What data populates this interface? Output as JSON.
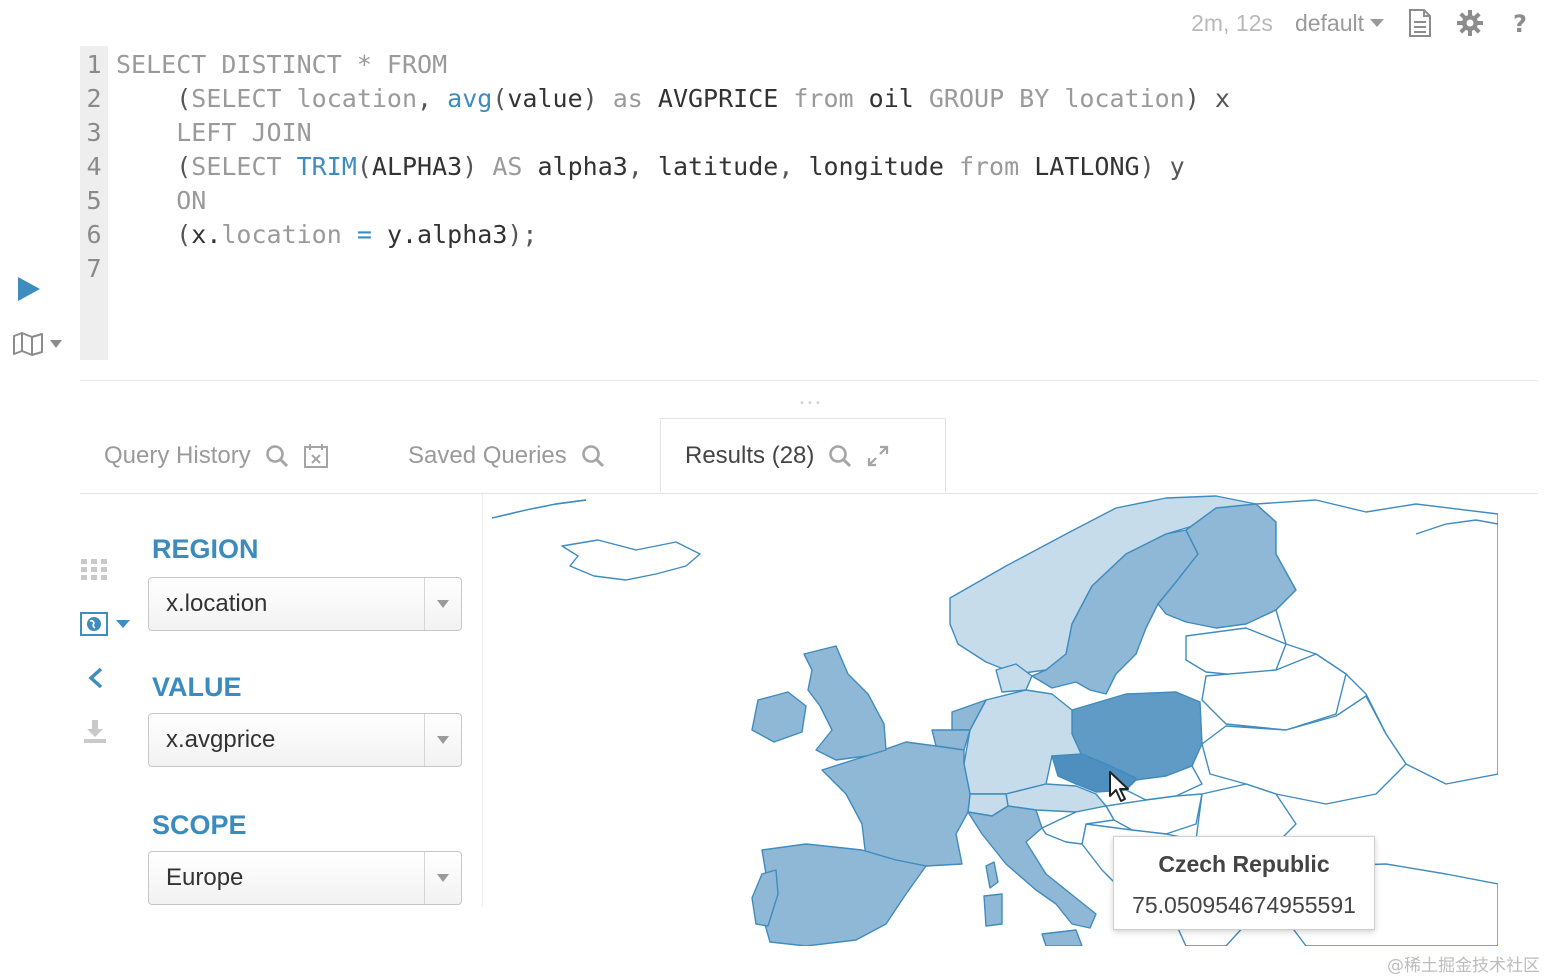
{
  "topbar": {
    "elapsed": "2m, 12s",
    "database": "default",
    "icons": [
      "document-icon",
      "gear-icon",
      "help-icon"
    ]
  },
  "editor": {
    "lines": [
      {
        "n": "1",
        "tokens": [
          [
            "kw",
            "SELECT DISTINCT * FROM"
          ]
        ]
      },
      {
        "n": "2",
        "tokens": [
          [
            "pn",
            "    ("
          ],
          [
            "kw",
            "SELECT "
          ],
          [
            "kw",
            "location"
          ],
          [
            "pn",
            ", "
          ],
          [
            "fn",
            "avg"
          ],
          [
            "pn",
            "("
          ],
          [
            "tx",
            "value"
          ],
          [
            "pn",
            ") "
          ],
          [
            "kw",
            "as "
          ],
          [
            "tx",
            "AVGPRICE "
          ],
          [
            "kw",
            "from "
          ],
          [
            "tx",
            "oil "
          ],
          [
            "kw",
            "GROUP BY "
          ],
          [
            "kw",
            "location"
          ],
          [
            "pn",
            ") x"
          ]
        ]
      },
      {
        "n": "3",
        "tokens": [
          [
            "kw",
            "    LEFT JOIN"
          ]
        ]
      },
      {
        "n": "4",
        "tokens": [
          [
            "pn",
            "    ("
          ],
          [
            "kw",
            "SELECT "
          ],
          [
            "fn",
            "TRIM"
          ],
          [
            "pn",
            "("
          ],
          [
            "tx",
            "ALPHA3"
          ],
          [
            "pn",
            ") "
          ],
          [
            "kw",
            "AS "
          ],
          [
            "tx",
            "alpha3"
          ],
          [
            "pn",
            ", "
          ],
          [
            "tx",
            "latitude"
          ],
          [
            "pn",
            ", "
          ],
          [
            "tx",
            "longitude "
          ],
          [
            "kw",
            "from "
          ],
          [
            "tx",
            "LATLONG"
          ],
          [
            "pn",
            ") y"
          ]
        ]
      },
      {
        "n": "5",
        "tokens": [
          [
            "kw",
            "    ON"
          ]
        ]
      },
      {
        "n": "6",
        "tokens": [
          [
            "pn",
            "    ("
          ],
          [
            "tx",
            "x."
          ],
          [
            "kw",
            "location "
          ],
          [
            "fn",
            "="
          ],
          [
            "tx",
            " y.alpha3"
          ],
          [
            "pn",
            ");"
          ]
        ]
      },
      {
        "n": "7",
        "tokens": []
      }
    ]
  },
  "tabs": [
    {
      "label": "Query History",
      "active": false
    },
    {
      "label": "Saved Queries",
      "active": false
    },
    {
      "label": "Results (28)",
      "active": true
    }
  ],
  "settings": {
    "region": {
      "label": "REGION",
      "value": "x.location"
    },
    "value": {
      "label": "VALUE",
      "value": "x.avgprice"
    },
    "scope": {
      "label": "SCOPE",
      "value": "Europe"
    }
  },
  "map": {
    "scope": "Europe",
    "highlighted_country": "Czech Republic",
    "highlighted_value": "75.050954674955591",
    "colors": {
      "water": "#ffffff",
      "border": "#3f8cbf",
      "low": "#c6dceb",
      "mid": "#8fb8d6",
      "high": "#5f9bc4",
      "empty": "#ffffff"
    }
  },
  "tooltip": {
    "name": "Czech Republic",
    "value": "75.050954674955591"
  },
  "watermark": "@稀土掘金技术社区"
}
